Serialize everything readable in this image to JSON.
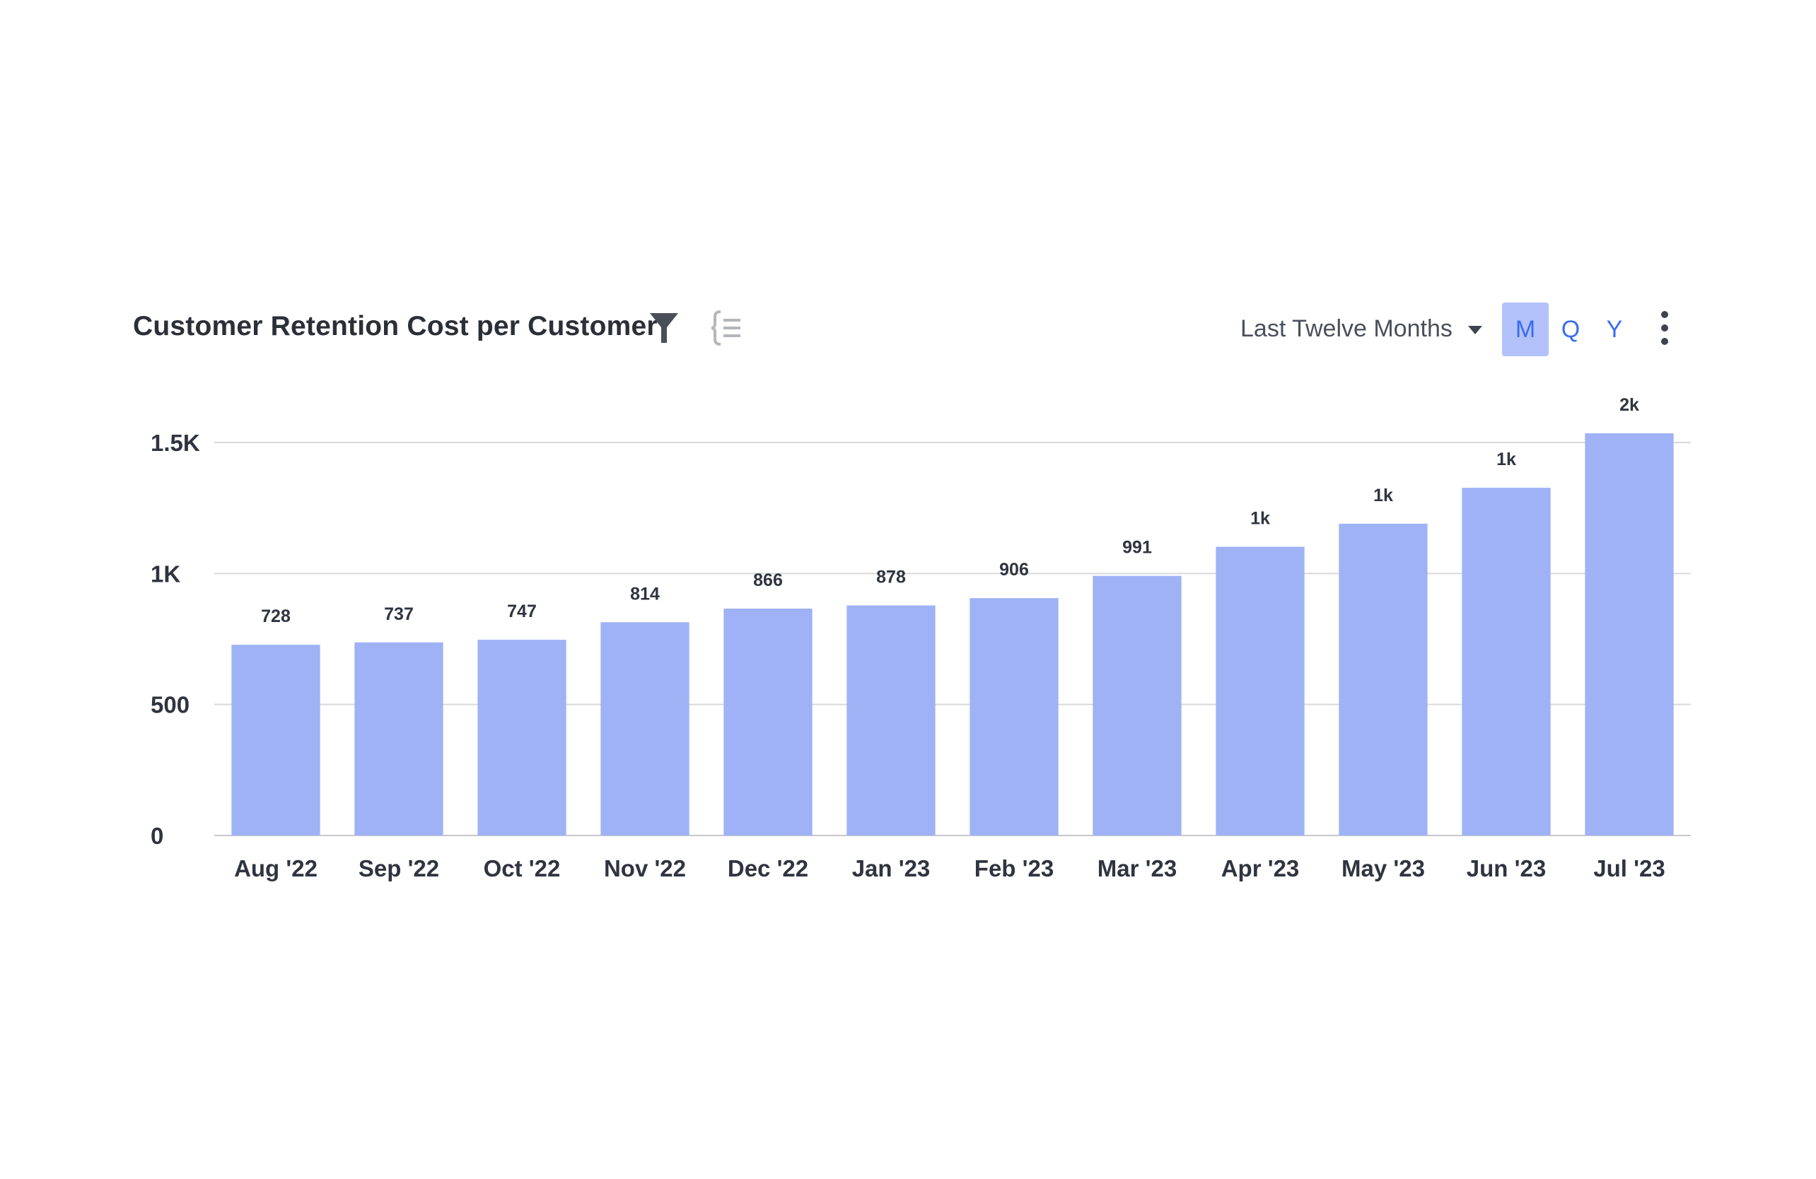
{
  "header": {
    "title": "Customer Retention Cost per Customer",
    "filter_icon": "filter-icon",
    "formula_icon": "formula-icon",
    "range_select": {
      "selected": "Last Twelve Months"
    },
    "period_buttons": [
      {
        "label": "M",
        "active": true
      },
      {
        "label": "Q",
        "active": false
      },
      {
        "label": "Y",
        "active": false
      }
    ],
    "more_icon": "kebab-menu-icon"
  },
  "colors": {
    "bar": "#9db0f5",
    "active_period_bg": "#b3c2fa",
    "period_text": "#3b6cf0",
    "gridline": "#d9d9dc"
  },
  "chart_data": {
    "type": "bar",
    "title": "Customer Retention Cost per Customer",
    "xlabel": "",
    "ylabel": "",
    "categories": [
      "Aug '22",
      "Sep '22",
      "Oct '22",
      "Nov '22",
      "Dec '22",
      "Jan '23",
      "Feb '23",
      "Mar '23",
      "Apr '23",
      "May '23",
      "Jun '23",
      "Jul '23"
    ],
    "values": [
      728,
      737,
      747,
      814,
      866,
      878,
      906,
      991,
      1102,
      1190,
      1327,
      1535
    ],
    "data_labels": [
      "728",
      "737",
      "747",
      "814",
      "866",
      "878",
      "906",
      "991",
      "1k",
      "1k",
      "1k",
      "2k"
    ],
    "ylim": [
      0,
      1500
    ],
    "yticks": [
      0,
      500,
      1000,
      1500
    ],
    "ytick_labels": [
      "0",
      "500",
      "1K",
      "1.5K"
    ],
    "grid": true,
    "legend": "none"
  }
}
